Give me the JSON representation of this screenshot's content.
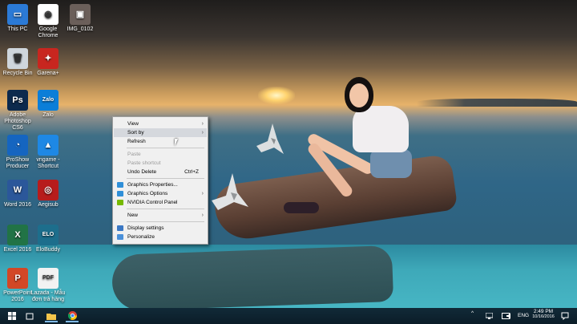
{
  "desktop": {
    "icons": [
      {
        "id": "this-pc",
        "label": "This PC",
        "color": "#2b7ad6",
        "glyph": "▭"
      },
      {
        "id": "chrome",
        "label": "Google Chrome",
        "color": "#ffffff",
        "glyph": "◉"
      },
      {
        "id": "img",
        "label": "IMG_0102",
        "color": "#6b5f5a",
        "glyph": "▣"
      },
      {
        "id": "recycle",
        "label": "Recycle Bin",
        "color": "#cfd6dc",
        "glyph": "🗑"
      },
      {
        "id": "garena",
        "label": "Garena+",
        "color": "#c8261f",
        "glyph": "✦"
      },
      {
        "id": "photoshop",
        "label": "Adobe Photoshop CS6",
        "color": "#0d2a4d",
        "glyph": "Ps"
      },
      {
        "id": "zalo",
        "label": "Zalo",
        "color": "#0b7ed8",
        "glyph": "Zalo"
      },
      {
        "id": "proshow",
        "label": "ProShow Producer",
        "color": "#1565c0",
        "glyph": "◔"
      },
      {
        "id": "vngame",
        "label": "vngame - Shortcut",
        "color": "#1e88e5",
        "glyph": "▲"
      },
      {
        "id": "word",
        "label": "Word 2016",
        "color": "#2b579a",
        "glyph": "W"
      },
      {
        "id": "aegisub",
        "label": "Aegisub",
        "color": "#b71c1c",
        "glyph": "◎"
      },
      {
        "id": "excel",
        "label": "Excel 2016",
        "color": "#217346",
        "glyph": "X"
      },
      {
        "id": "elobuddy",
        "label": "EloBuddy",
        "color": "#1d6e8c",
        "glyph": "ELO"
      },
      {
        "id": "powerpoint",
        "label": "PowerPoint 2016",
        "color": "#d24726",
        "glyph": "P"
      },
      {
        "id": "lazada",
        "label": "Lazada - Mẫu đơn trả hàng",
        "color": "#f2f2f2",
        "glyph": "PDF"
      }
    ]
  },
  "context_menu": {
    "view": "View",
    "sort_by": "Sort by",
    "refresh": "Refresh",
    "paste": "Paste",
    "paste_shortcut": "Paste shortcut",
    "undo_delete": "Undo Delete",
    "undo_delete_shortcut": "Ctrl+Z",
    "graphics_properties": "Graphics Properties...",
    "graphics_options": "Graphics Options",
    "nvidia": "NVIDIA Control Panel",
    "new": "New",
    "display_settings": "Display settings",
    "personalize": "Personalize",
    "submenu_arrow": "›"
  },
  "taskbar": {
    "language": "ENG",
    "time": "2:49 PM",
    "date": "10/16/2016",
    "tray_chevron": "^"
  }
}
